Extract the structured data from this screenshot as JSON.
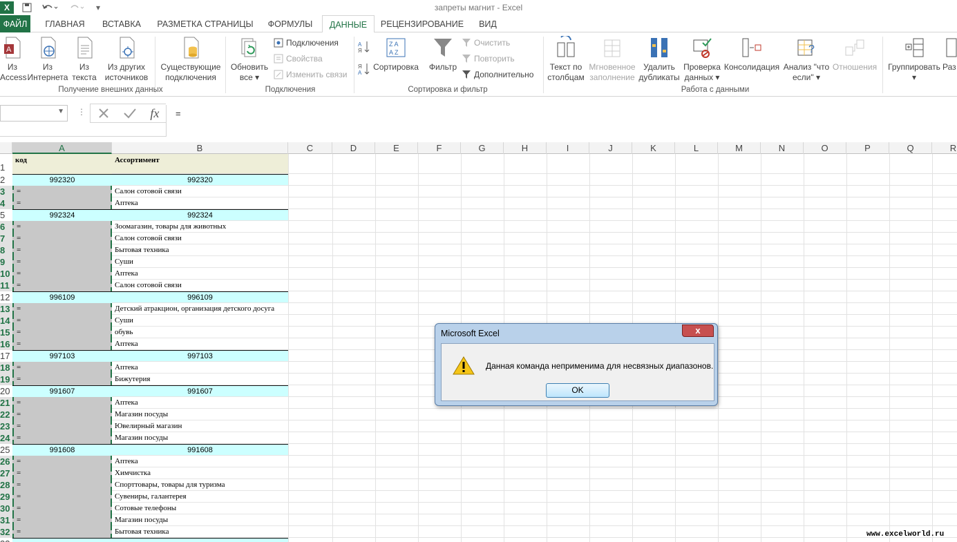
{
  "window": {
    "title": "запреты магнит - Excel"
  },
  "tabs": [
    {
      "label": "ФАЙЛ"
    },
    {
      "label": "ГЛАВНАЯ"
    },
    {
      "label": "ВСТАВКА"
    },
    {
      "label": "РАЗМЕТКА СТРАНИЦЫ"
    },
    {
      "label": "ФОРМУЛЫ"
    },
    {
      "label": "ДАННЫЕ"
    },
    {
      "label": "РЕЦЕНЗИРОВАНИЕ"
    },
    {
      "label": "ВИД"
    }
  ],
  "ribbon": {
    "external": {
      "access_l1": "Из",
      "access_l2": "Access",
      "web_l1": "Из",
      "web_l2": "Интернета",
      "text_l1": "Из",
      "text_l2": "текста",
      "other_l1": "Из других",
      "other_l2": "источников",
      "existing_l1": "Существующие",
      "existing_l2": "подключения",
      "group": "Получение внешних данных"
    },
    "connections": {
      "refresh_l1": "Обновить",
      "refresh_l2": "все",
      "conn": "Подключения",
      "props": "Свойства",
      "edit": "Изменить связи",
      "group": "Подключения"
    },
    "sort": {
      "sort": "Сортировка",
      "filter": "Фильтр",
      "clear": "Очистить",
      "reapply": "Повторить",
      "advanced": "Дополнительно",
      "group": "Сортировка и фильтр"
    },
    "tools": {
      "t2c_l1": "Текст по",
      "t2c_l2": "столбцам",
      "flash_l1": "Мгновенное",
      "flash_l2": "заполнение",
      "dup_l1": "Удалить",
      "dup_l2": "дубликаты",
      "valid_l1": "Проверка",
      "valid_l2": "данных",
      "consol": "Консолидация",
      "whatif_l1": "Анализ \"что",
      "whatif_l2": "если\"",
      "rel": "Отношения",
      "group": "Работа с данными"
    },
    "outline": {
      "group_btn": "Группировать",
      "ungroup": "Раз"
    }
  },
  "formula_bar": {
    "content": "="
  },
  "columns": [
    "A",
    "B",
    "C",
    "D",
    "E",
    "F",
    "G",
    "H",
    "I",
    "J",
    "K",
    "L",
    "M",
    "N",
    "O",
    "P",
    "Q",
    "R"
  ],
  "rows": [
    {
      "n": "1",
      "a": "код",
      "b": "Ассортимент",
      "type": "header"
    },
    {
      "n": "2",
      "a": "992320",
      "b": "992320",
      "type": "group"
    },
    {
      "n": "3",
      "a": "=",
      "b": "Салон сотовой связи",
      "type": "item"
    },
    {
      "n": "4",
      "a": "=",
      "b": "Аптека",
      "type": "item"
    },
    {
      "n": "5",
      "a": "992324",
      "b": "992324",
      "type": "group"
    },
    {
      "n": "6",
      "a": "=",
      "b": "Зоомагазин, товары для животных",
      "type": "item"
    },
    {
      "n": "7",
      "a": "=",
      "b": "Салон сотовой связи",
      "type": "item"
    },
    {
      "n": "8",
      "a": "=",
      "b": "Бытовая техника",
      "type": "item"
    },
    {
      "n": "9",
      "a": "=",
      "b": "Суши",
      "type": "item"
    },
    {
      "n": "10",
      "a": "=",
      "b": "Аптека",
      "type": "item"
    },
    {
      "n": "11",
      "a": "=",
      "b": "Салон сотовой связи",
      "type": "item"
    },
    {
      "n": "12",
      "a": "996109",
      "b": "996109",
      "type": "group"
    },
    {
      "n": "13",
      "a": "=",
      "b": "Детский атракцион, организация детского досуга",
      "type": "item"
    },
    {
      "n": "14",
      "a": "=",
      "b": "Суши",
      "type": "item"
    },
    {
      "n": "15",
      "a": "=",
      "b": "обувь",
      "type": "item"
    },
    {
      "n": "16",
      "a": "=",
      "b": "Аптека",
      "type": "item"
    },
    {
      "n": "17",
      "a": "997103",
      "b": "997103",
      "type": "group"
    },
    {
      "n": "18",
      "a": "=",
      "b": "Аптека",
      "type": "item"
    },
    {
      "n": "19",
      "a": "=",
      "b": "Бижутерия",
      "type": "item"
    },
    {
      "n": "20",
      "a": "991607",
      "b": "991607",
      "type": "group"
    },
    {
      "n": "21",
      "a": "=",
      "b": "Аптека",
      "type": "item"
    },
    {
      "n": "22",
      "a": "=",
      "b": "Магазин посуды",
      "type": "item"
    },
    {
      "n": "23",
      "a": "=",
      "b": "Ювелирный магазин",
      "type": "item"
    },
    {
      "n": "24",
      "a": "=",
      "b": "Магазин посуды",
      "type": "item"
    },
    {
      "n": "25",
      "a": "991608",
      "b": "991608",
      "type": "group"
    },
    {
      "n": "26",
      "a": "=",
      "b": "Аптека",
      "type": "item"
    },
    {
      "n": "27",
      "a": "=",
      "b": "Химчистка",
      "type": "item"
    },
    {
      "n": "28",
      "a": "=",
      "b": "Спорттовары, товары для туризма",
      "type": "item"
    },
    {
      "n": "29",
      "a": "=",
      "b": "Сувениры, галантерея",
      "type": "item"
    },
    {
      "n": "30",
      "a": "=",
      "b": "Сотовые телефоны",
      "type": "item"
    },
    {
      "n": "31",
      "a": "=",
      "b": "Магазин посуды",
      "type": "item"
    },
    {
      "n": "32",
      "a": "=",
      "b": "Бытовая техника",
      "type": "item"
    },
    {
      "n": "33",
      "a": "",
      "b": "",
      "type": "group"
    }
  ],
  "dialog": {
    "title": "Microsoft Excel",
    "close": "x",
    "message": "Данная команда неприменима для несвязных диапазонов.",
    "ok": "OK"
  },
  "watermark": "www.excelworld.ru",
  "colors": {
    "excel_green": "#217346",
    "cyan_fill": "#ccffff",
    "gray_fill": "#c8c8c8",
    "header_fill": "#eeeed8"
  }
}
